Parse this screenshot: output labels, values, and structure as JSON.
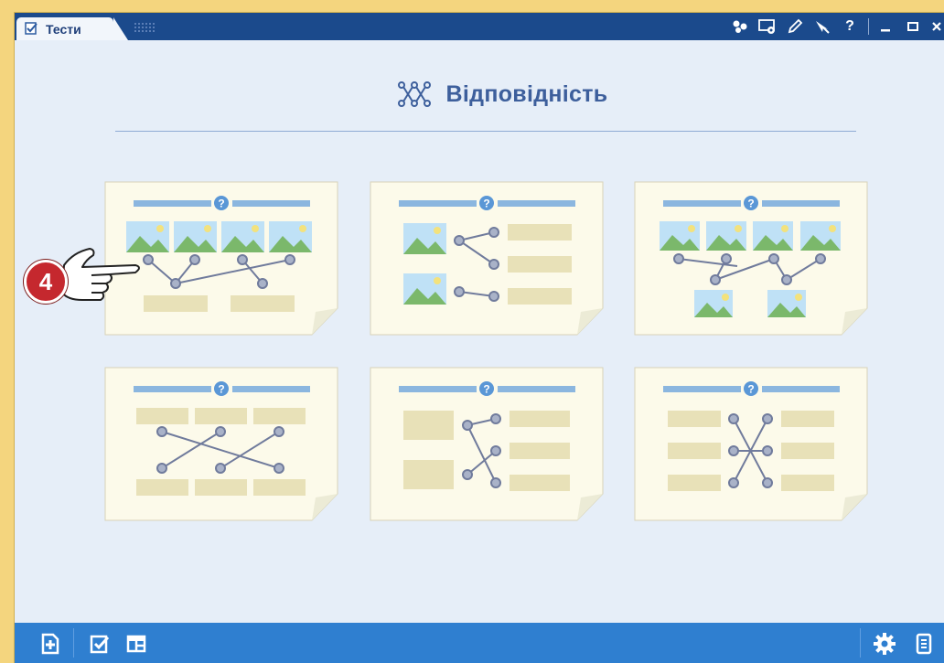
{
  "window": {
    "tab_label": "Тести",
    "toolbar_icons": [
      "users-icon",
      "settings-screen-icon",
      "pencil-icon",
      "pointer-icon",
      "help-icon",
      "minimize-icon",
      "maximize-icon",
      "close-icon"
    ],
    "help_label": "?"
  },
  "page": {
    "title": "Відповідність",
    "title_icon": "matching-icon"
  },
  "templates": [
    {
      "id": "images-to-labels",
      "icon": "help-icon"
    },
    {
      "id": "images-to-text-right",
      "icon": "help-icon"
    },
    {
      "id": "images-to-images",
      "icon": "help-icon"
    },
    {
      "id": "text-to-text-cross",
      "icon": "help-icon"
    },
    {
      "id": "text-block-to-text",
      "icon": "help-icon"
    },
    {
      "id": "text-to-text-columns",
      "icon": "help-icon"
    }
  ],
  "callout": {
    "number": "4"
  },
  "bottom_bar": {
    "icons": [
      "add-page-icon",
      "check-edit-icon",
      "layout-icon",
      "gear-icon",
      "notes-icon"
    ]
  },
  "colors": {
    "title_bar": "#1b4a8c",
    "background": "#e6eef8",
    "card": "#fcfaea",
    "accent": "#3d5f9c",
    "bottom_bar": "#2f7fd0",
    "badge": "#c5282e"
  }
}
